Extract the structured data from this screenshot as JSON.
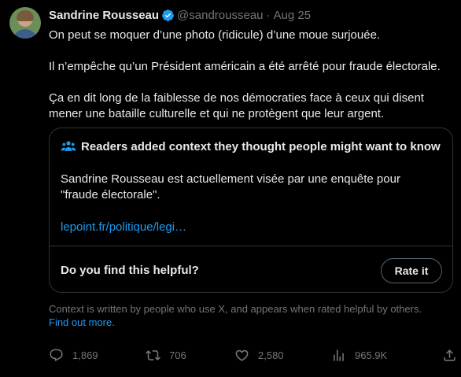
{
  "author": {
    "display_name": "Sandrine Rousseau",
    "handle": "@sandrousseau",
    "separator": "·",
    "date": "Aug 25",
    "verified_icon": "verified-badge-icon"
  },
  "tweet": {
    "paragraphs": [
      "On peut se moquer d’une photo (ridicule) d’une moue surjouée.",
      "Il n’empêche qu’un Président américain a été arrêté pour fraude électorale.",
      "Ça en dit long de la faiblesse de nos démocraties face à ceux qui disent mener une bataille culturelle et qui ne protègent que leur argent."
    ]
  },
  "community_note": {
    "header": "Readers added context they thought people might want to know",
    "header_icon": "people-icon",
    "body": "Sandrine Rousseau est actuellement visée par une enquête pour \"fraude électorale\".",
    "link": "lepoint.fr/politique/legi…",
    "helpful_question": "Do you find this helpful?",
    "rate_label": "Rate it"
  },
  "context_footer": {
    "text": "Context is written by people who use X, and appears when rated helpful by others.",
    "link": "Find out more."
  },
  "actions": {
    "replies": "1,869",
    "reposts": "706",
    "likes": "2,580",
    "views": "965.9K"
  },
  "colors": {
    "background": "#000000",
    "text": "#e7e9ea",
    "secondary": "#71767b",
    "link": "#1d9bf0",
    "border": "#2f3336"
  }
}
